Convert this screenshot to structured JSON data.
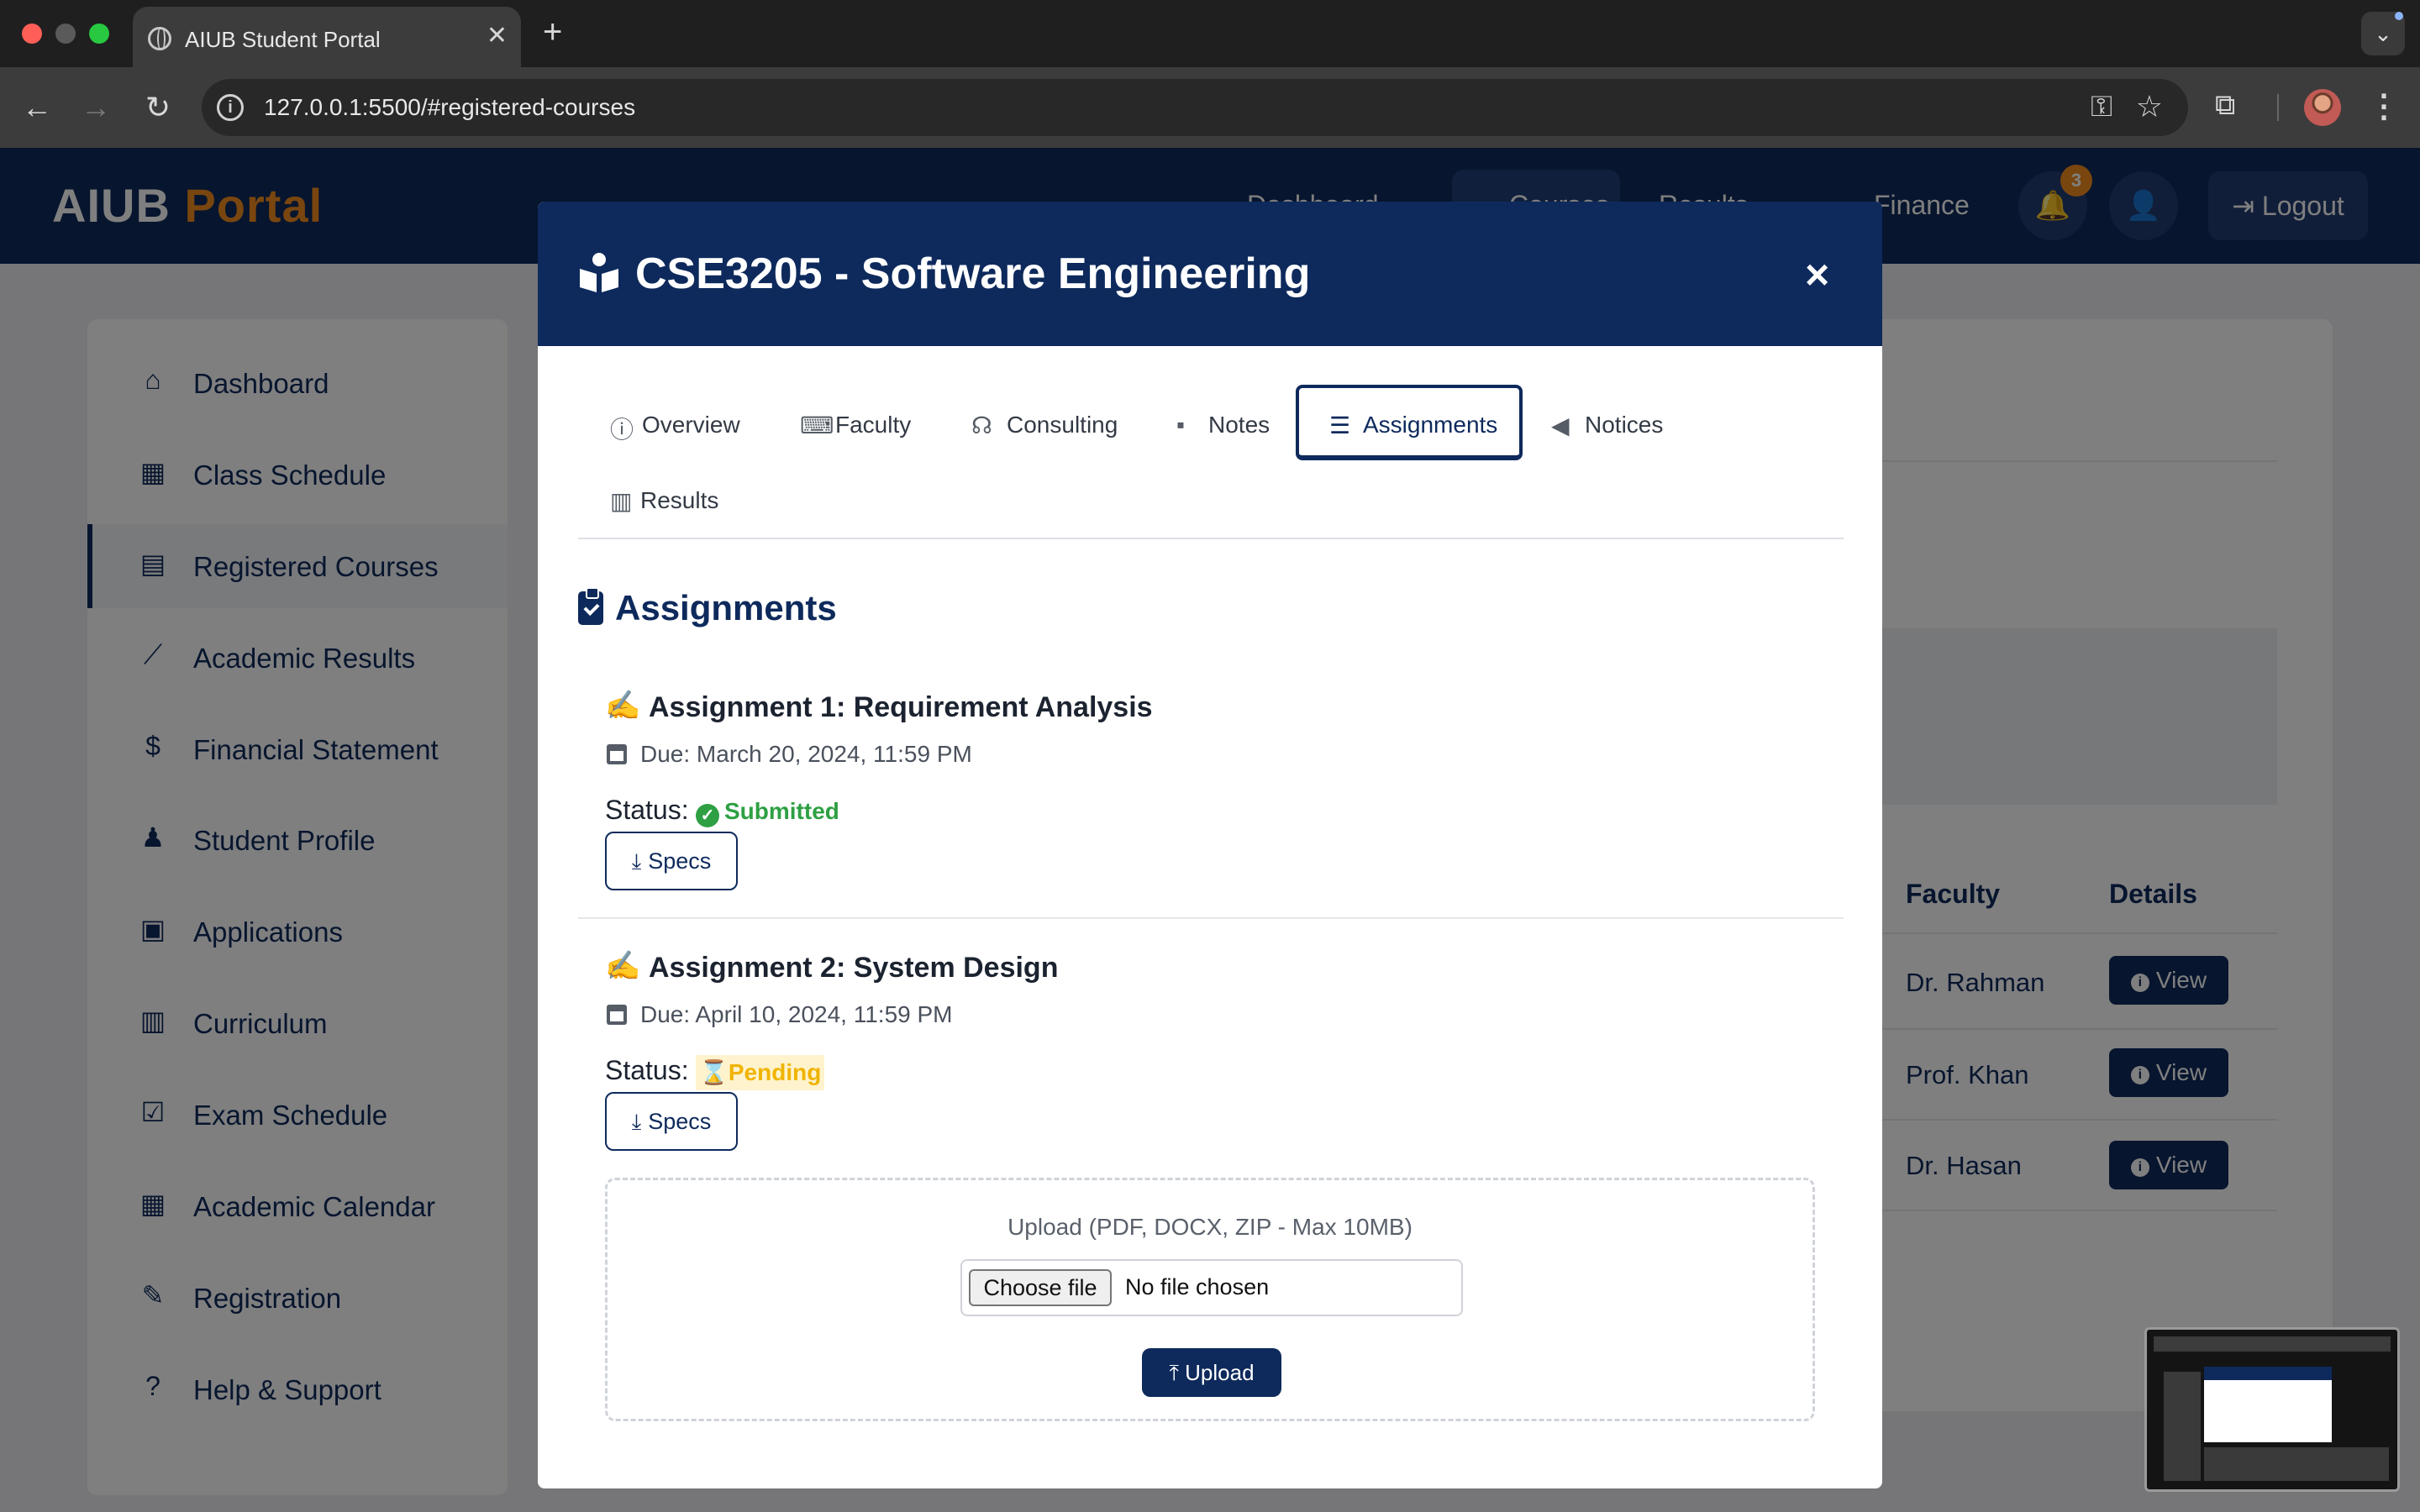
{
  "browser": {
    "tab_title": "AIUB Student Portal",
    "url": "127.0.0.1:5500/#registered-courses"
  },
  "site": {
    "logo_main": "AIUB",
    "logo_accent": "Portal",
    "nav": [
      "Dashboard",
      "Courses",
      "Results",
      "Finance"
    ],
    "notifications_count": "3",
    "logout": "Logout"
  },
  "sidebar": {
    "items": [
      {
        "label": "Dashboard",
        "icon": "home-icon"
      },
      {
        "label": "Class Schedule",
        "icon": "calendar-icon"
      },
      {
        "label": "Registered Courses",
        "icon": "book-icon"
      },
      {
        "label": "Academic Results",
        "icon": "chart-line-icon"
      },
      {
        "label": "Financial Statement",
        "icon": "invoice-icon"
      },
      {
        "label": "Student Profile",
        "icon": "graduate-icon"
      },
      {
        "label": "Applications",
        "icon": "clipboard-icon"
      },
      {
        "label": "Curriculum",
        "icon": "open-book-icon"
      },
      {
        "label": "Exam Schedule",
        "icon": "calendar-check-icon"
      },
      {
        "label": "Academic Calendar",
        "icon": "calendar-icon"
      },
      {
        "label": "Registration",
        "icon": "edit-icon"
      },
      {
        "label": "Help & Support",
        "icon": "help-icon"
      }
    ]
  },
  "background_table": {
    "headers": [
      "Faculty",
      "Details"
    ],
    "rows": [
      {
        "faculty": "Dr. Rahman",
        "action": "View"
      },
      {
        "faculty": "Prof. Khan",
        "action": "View"
      },
      {
        "faculty": "Dr. Hasan",
        "action": "View"
      }
    ]
  },
  "modal": {
    "title": "CSE3205 - Software Engineering",
    "close": "×",
    "tabs": [
      {
        "label": "Overview",
        "icon": "info-icon"
      },
      {
        "label": "Faculty",
        "icon": "chalkboard-teacher-icon"
      },
      {
        "label": "Consulting",
        "icon": "headset-icon"
      },
      {
        "label": "Notes",
        "icon": "sticky-note-icon"
      },
      {
        "label": "Assignments",
        "icon": "tasks-icon"
      },
      {
        "label": "Notices",
        "icon": "megaphone-icon"
      },
      {
        "label": "Results",
        "icon": "bar-chart-icon"
      }
    ],
    "active_tab": "Assignments",
    "section_title": "Assignments",
    "status_label": "Status:",
    "spec_label": "Specs",
    "assignments": [
      {
        "title": "Assignment 1: Requirement Analysis",
        "due": "Due: March 20, 2024, 11:59 PM",
        "status": "Submitted"
      },
      {
        "title": "Assignment 2: System Design",
        "due": "Due: April 10, 2024, 11:59 PM",
        "status": "Pending"
      }
    ],
    "upload": {
      "hint": "Upload (PDF, DOCX, ZIP - Max 10MB)",
      "choose_file": "Choose file",
      "no_file": "No file chosen",
      "button": "Upload"
    }
  },
  "colors": {
    "brand_navy": "#0e2a5c",
    "accent_orange": "#f28c1e",
    "success_green": "#2ea043",
    "pending_amber": "#f0b400"
  }
}
